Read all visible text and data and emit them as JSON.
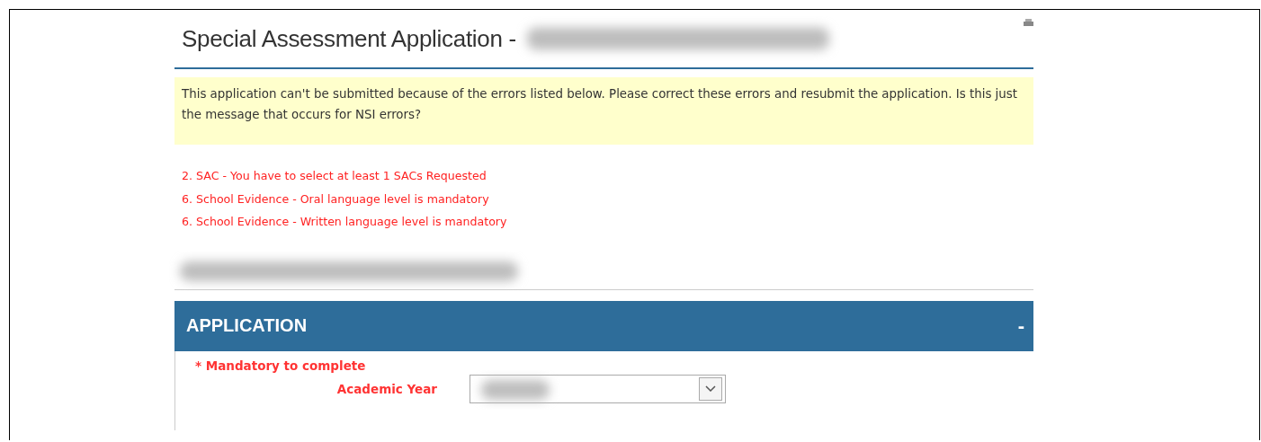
{
  "page": {
    "title": "Special Assessment Application -"
  },
  "notice": {
    "text": "This application can't be submitted because of the errors listed below. Please correct these errors and resubmit the application. Is this just the message that occurs for NSI errors?"
  },
  "errors": [
    "2. SAC - You have to select at least 1 SACs Requested",
    "6. School Evidence - Oral language level is mandatory",
    "6. School Evidence - Written language level is mandatory"
  ],
  "section": {
    "title": "APPLICATION",
    "toggle": "-",
    "mandatory_note": "* Mandatory to complete",
    "fields": [
      {
        "kind": "select",
        "label": "Academic Year"
      }
    ]
  }
}
